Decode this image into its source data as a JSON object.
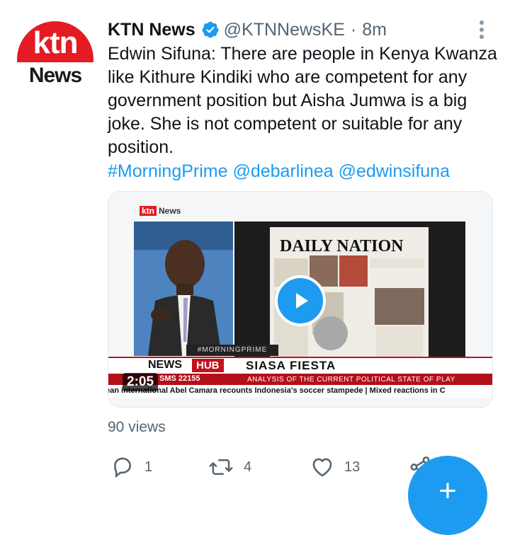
{
  "tweet": {
    "author_name": "KTN News",
    "handle": "@KTNNewsKE",
    "separator": "·",
    "time": "8m",
    "text_lines": [
      "Edwin Sifuna: There are people in Kenya Kwanza",
      "like Kithure Kindiki who are competent for any",
      "government position but Aisha Jumwa is a big",
      "joke. She is not competent or suitable for any",
      "position."
    ],
    "hashtags": [
      "#MorningPrime",
      "@debarlinea",
      "@edwinsifuna"
    ],
    "avatar": {
      "line1": "ktn",
      "line2": "News"
    }
  },
  "video": {
    "duration": "2:05",
    "channel_logo": {
      "part1": "ktn",
      "part2": "News"
    },
    "newspaper_title": "DAILY NATION",
    "hashtag_strip": "#MORNINGPRIME",
    "lower_third": {
      "news": "NEWS",
      "hub": "HUB",
      "segment": "SIASA FIESTA",
      "sms": "SMS 22155",
      "analysis": "ANALYSIS OF THE CURRENT POLITICAL STATE OF PLAY",
      "ticker": "ean international Abel Camara recounts Indonesia's soccer stampede | Mixed reactions in C"
    }
  },
  "stats": {
    "views": "90 views"
  },
  "actions": {
    "replies": "1",
    "retweets": "4",
    "likes": "13"
  },
  "colors": {
    "accent": "#1d9bf0",
    "muted": "#536471",
    "brand_red": "#e41b23"
  },
  "icons": [
    "verified-badge-icon",
    "more-vertical-icon",
    "reply-icon",
    "retweet-icon",
    "like-icon",
    "share-icon",
    "play-icon",
    "plus-icon"
  ]
}
